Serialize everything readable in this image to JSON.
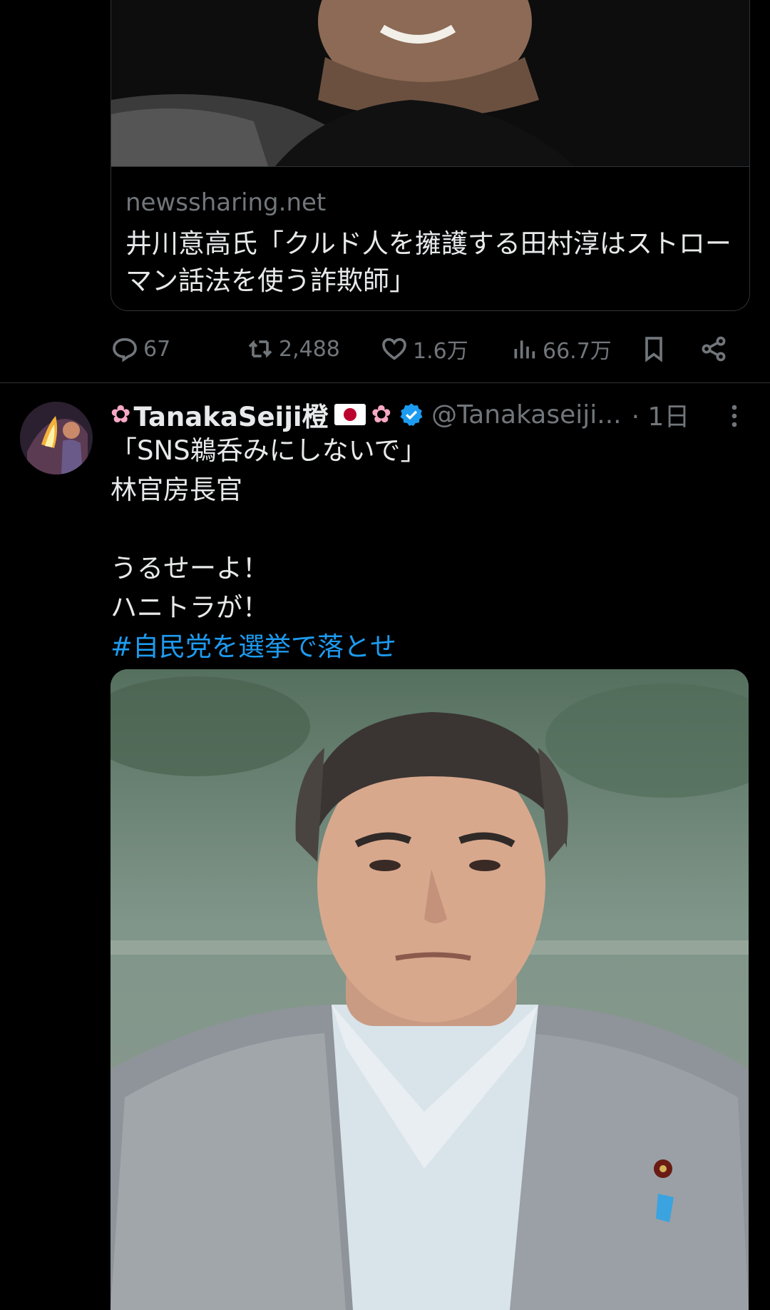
{
  "tweet1": {
    "card": {
      "domain": "newssharing.net",
      "title": "井川意高氏「クルド人を擁護する田村淳はストローマン話法を使う詐欺師」"
    },
    "actions": {
      "replies": "67",
      "retweets": "2,488",
      "likes": "1.6万",
      "views": "66.7万"
    }
  },
  "tweet2": {
    "author": {
      "name": "TanakaSeiji橙",
      "handle": "@Tanakaseiji...",
      "time": "· 1日"
    },
    "text": {
      "line1": "「SNS鵜呑みにしないで」",
      "line2": "林官房長官",
      "line3": "うるせーよ！",
      "line4": "ハニトラが！",
      "hashtag": "#自民党を選挙で落とせ"
    }
  },
  "colors": {
    "background": "#000000",
    "text": "#e7e9ea",
    "secondary": "#71767b",
    "link": "#1d9bf0",
    "border": "#2f3336"
  },
  "icons": [
    "reply-icon",
    "retweet-icon",
    "like-icon",
    "views-icon",
    "bookmark-icon",
    "share-icon",
    "verified-icon",
    "more-icon"
  ]
}
